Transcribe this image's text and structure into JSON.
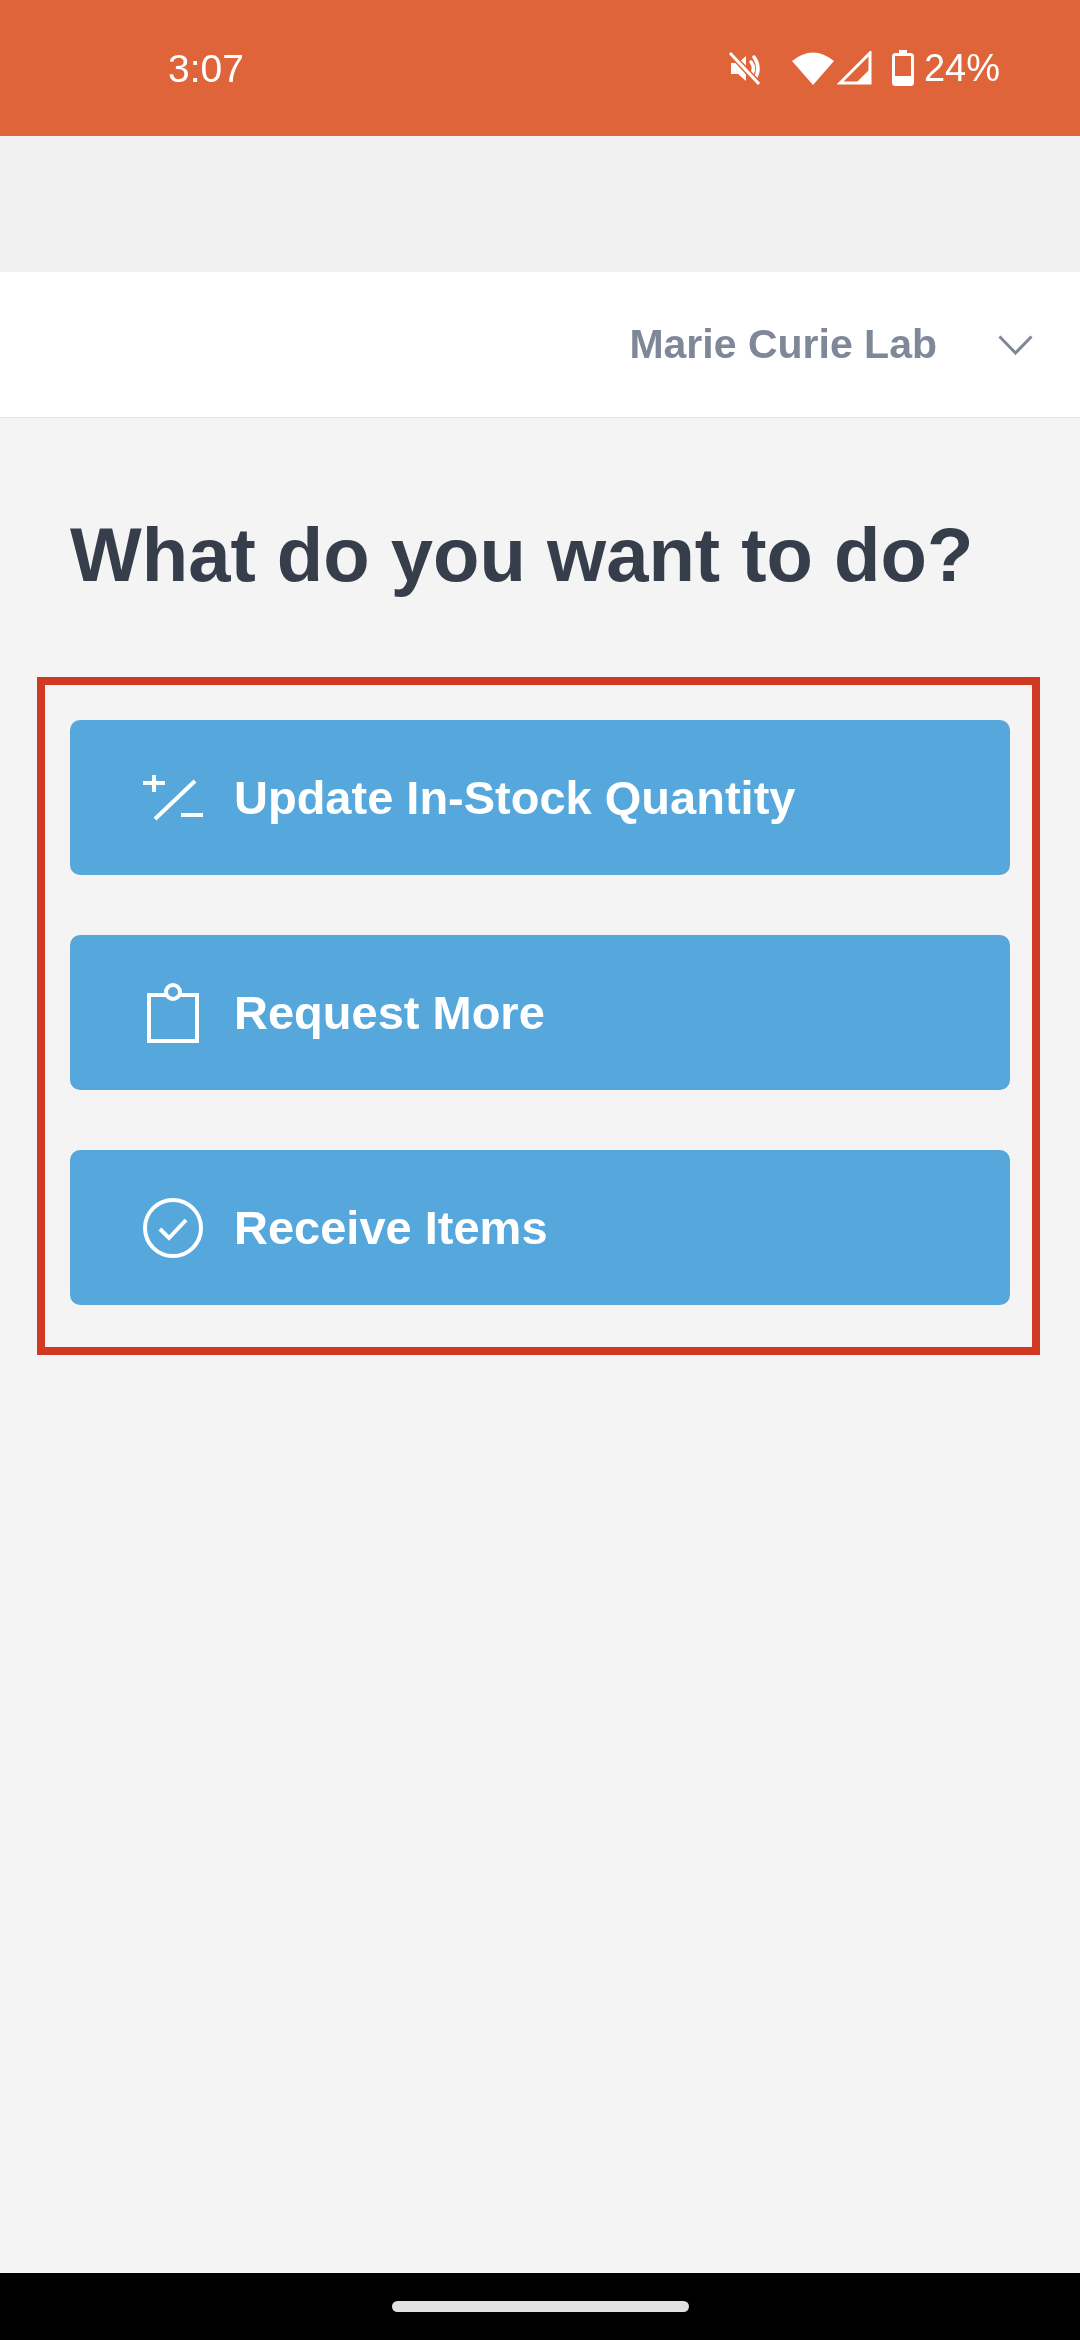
{
  "status_bar": {
    "time": "3:07",
    "battery": "24%"
  },
  "header": {
    "lab_selector": {
      "label": "Marie Curie Lab"
    }
  },
  "title": "What do you want to do?",
  "actions": {
    "highlighted": true,
    "buttons": [
      {
        "kind": "adjust",
        "label": "Update In-Stock Quantity"
      },
      {
        "kind": "request",
        "label": "Request More"
      },
      {
        "kind": "receive",
        "label": "Receive Items"
      }
    ]
  }
}
